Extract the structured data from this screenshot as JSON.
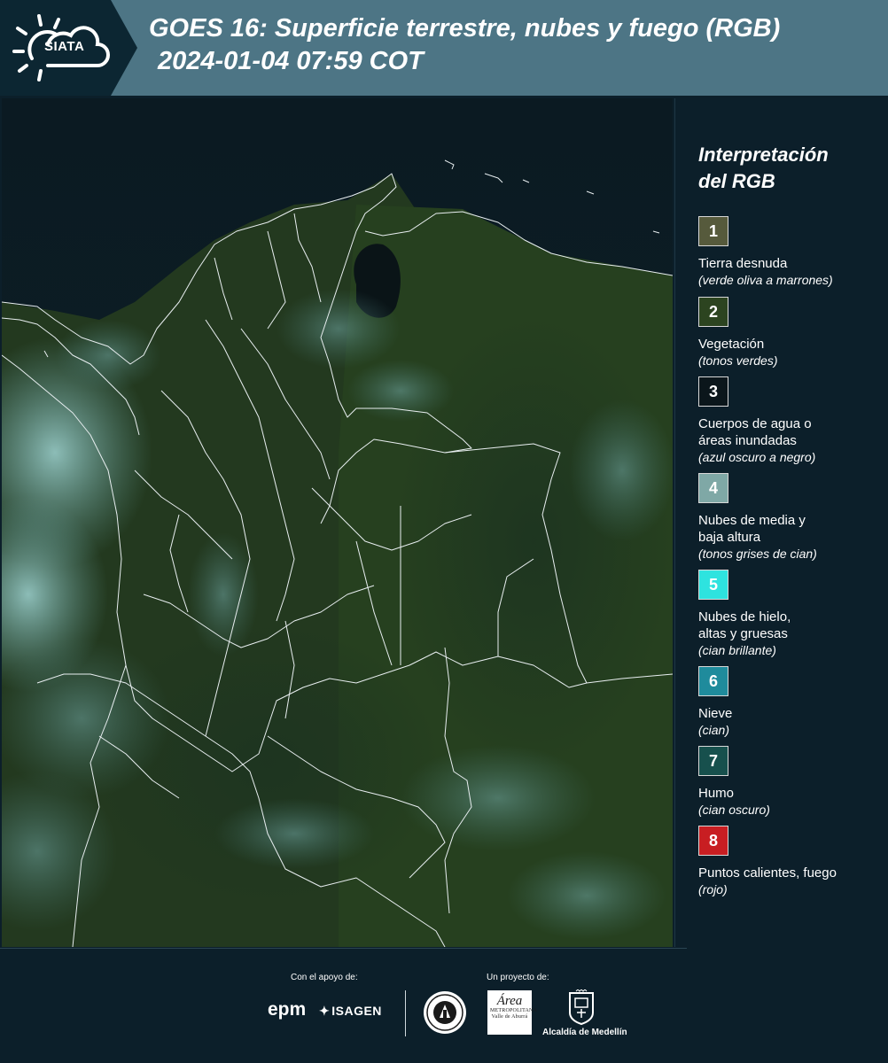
{
  "header": {
    "logo_text": "SIATA",
    "title_line1": "GOES 16: Superficie terrestre, nubes y fuego (RGB)",
    "title_line2": "2024-01-04 07:59 COT"
  },
  "legend": {
    "title_line1": "Interpretación",
    "title_line2": "del RGB",
    "items": [
      {
        "number": "1",
        "color": "#565a3c",
        "label_lines": [
          "Tierra desnuda"
        ],
        "sub": "(verde oliva a marrones)"
      },
      {
        "number": "2",
        "color": "#2c4420",
        "label_lines": [
          "Vegetación"
        ],
        "sub": "(tonos verdes)"
      },
      {
        "number": "3",
        "color": "#0b161b",
        "label_lines": [
          "Cuerpos de agua o",
          "áreas inundadas"
        ],
        "sub": "(azul oscuro a negro)"
      },
      {
        "number": "4",
        "color": "#7fa8a6",
        "label_lines": [
          "Nubes de media y",
          "baja altura"
        ],
        "sub": "(tonos grises de cian)"
      },
      {
        "number": "5",
        "color": "#2ee3df",
        "label_lines": [
          "Nubes de hielo,",
          "altas y gruesas"
        ],
        "sub": "(cian brillante)"
      },
      {
        "number": "6",
        "color": "#1f8b9c",
        "label_lines": [
          "Nieve"
        ],
        "sub": "(cian)"
      },
      {
        "number": "7",
        "color": "#17504d",
        "label_lines": [
          "Humo"
        ],
        "sub": "(cian oscuro)"
      },
      {
        "number": "8",
        "color": "#c81e22",
        "label_lines": [
          "Puntos calientes, fuego"
        ],
        "sub": "(rojo)"
      }
    ]
  },
  "footer": {
    "support_caption": "Con el apoyo de:",
    "project_caption": "Un proyecto de:",
    "sponsor_epm": "epm",
    "sponsor_isagen": "ISAGEN",
    "area_logo_big": "Área",
    "area_logo_small1": "METROPOLITANA",
    "area_logo_small2": "Valle de Aburrá",
    "alcaldia": "Alcaldía de Medellín"
  }
}
